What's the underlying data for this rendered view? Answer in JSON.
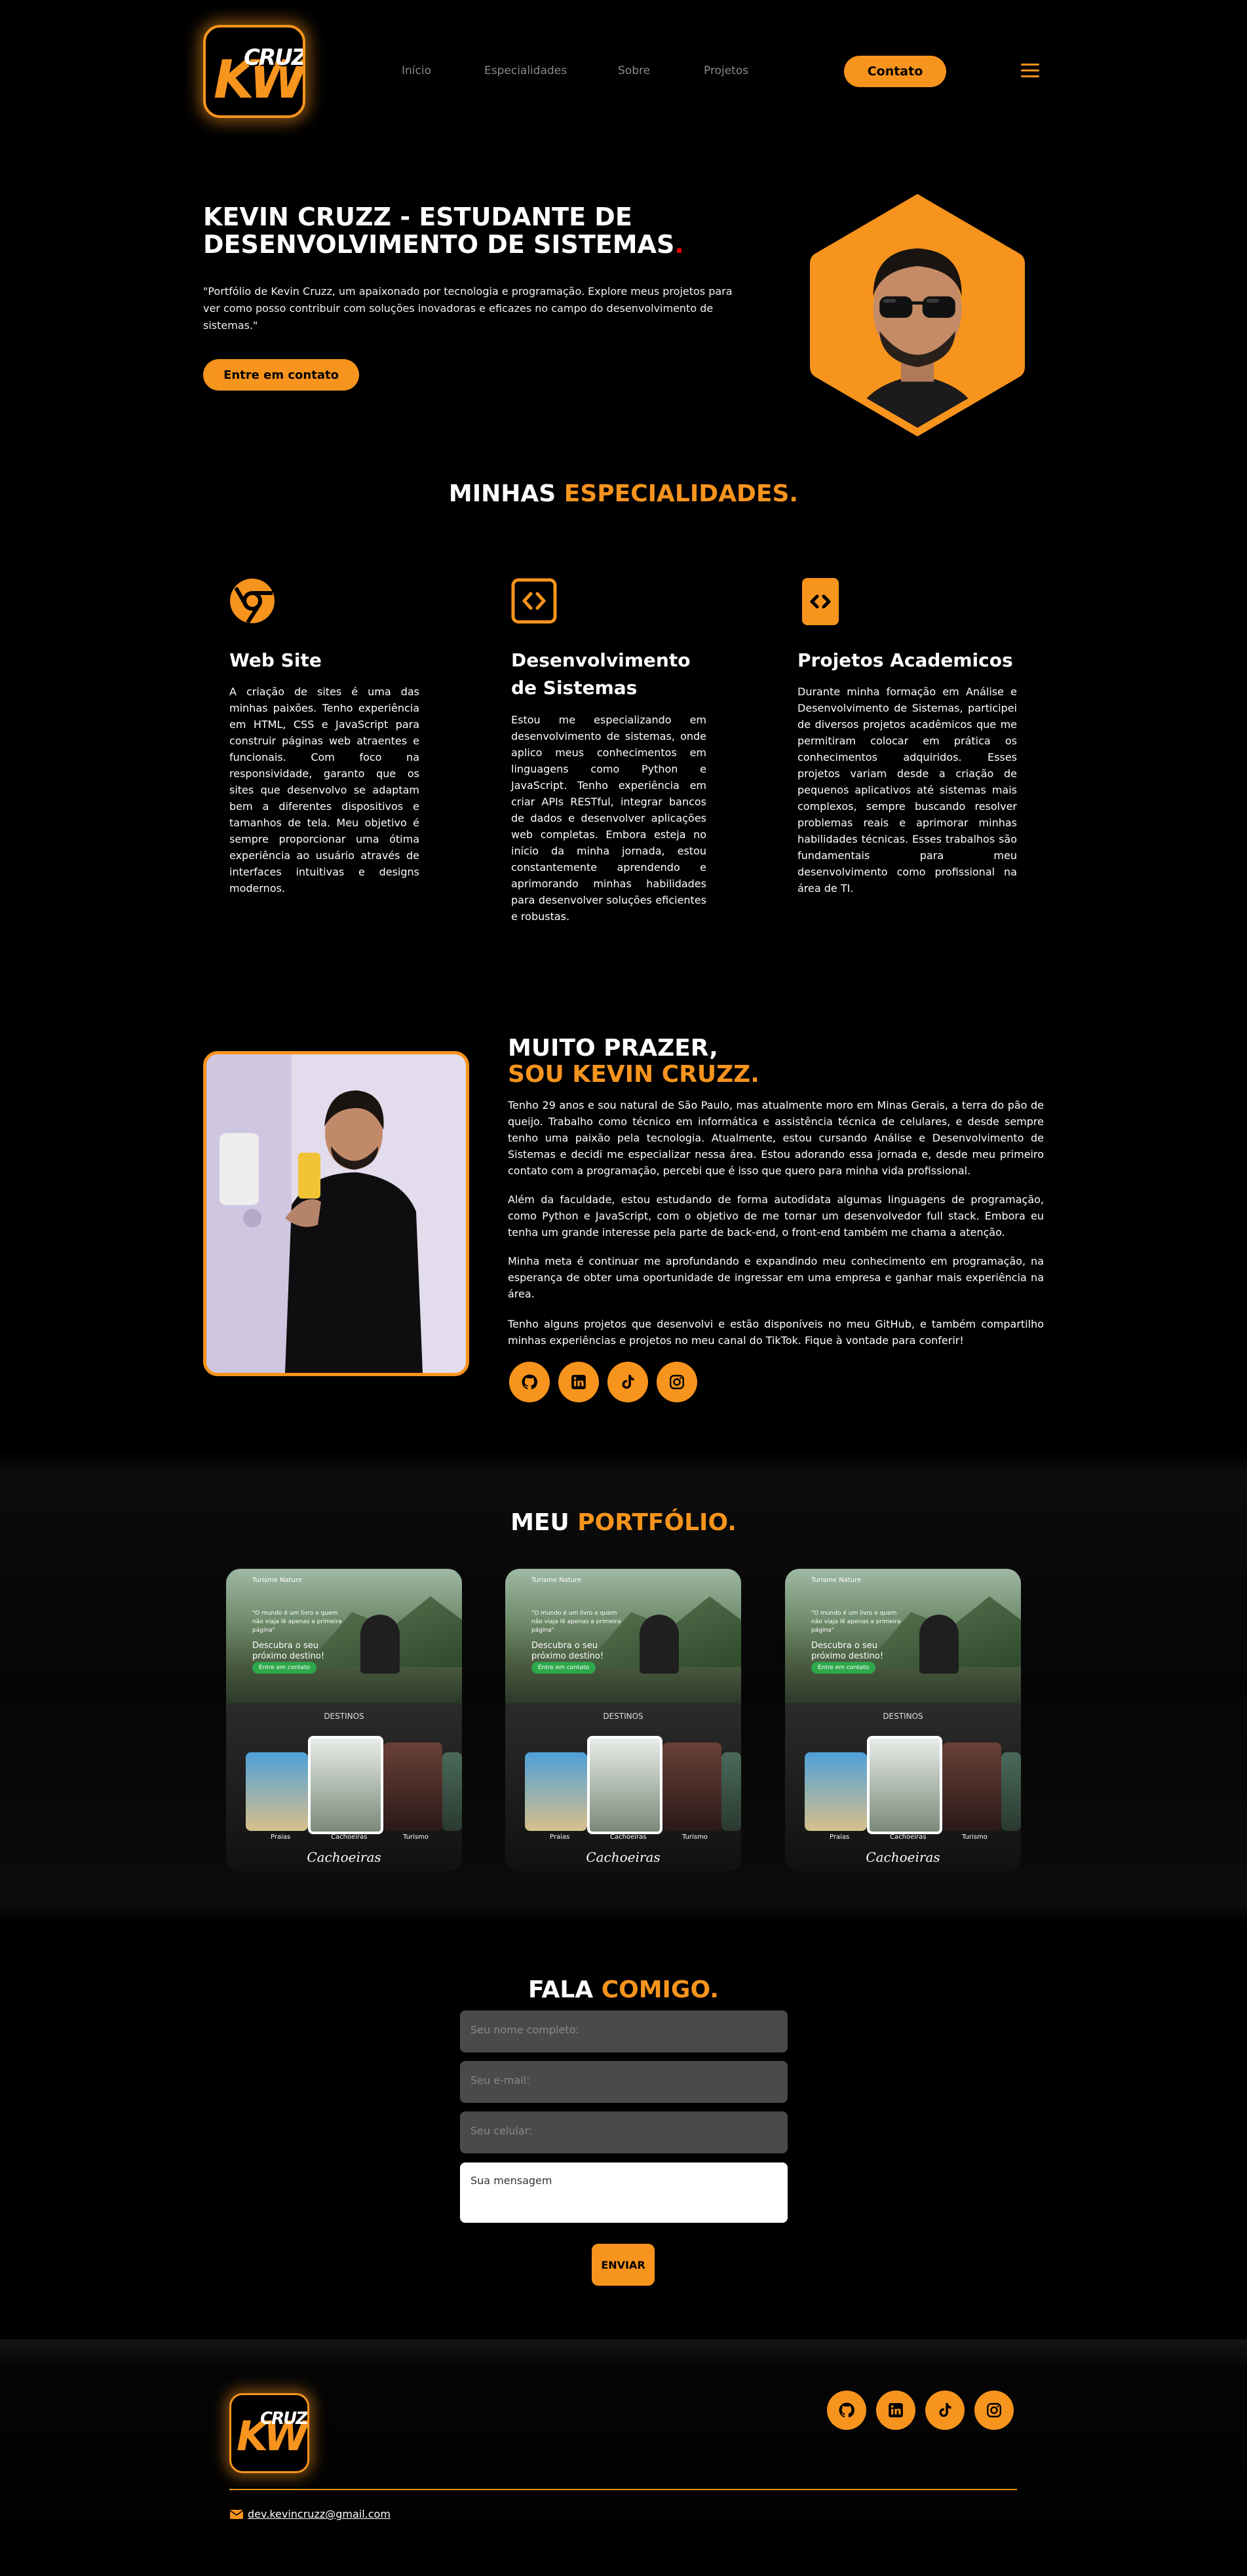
{
  "brand": {
    "logo_main": "KW",
    "logo_top": "CRUZZ"
  },
  "nav": {
    "items": [
      "Início",
      "Especialidades",
      "Sobre",
      "Projetos"
    ],
    "contact_label": "Contato"
  },
  "hero": {
    "title_line1": "KEVIN CRUZZ - ESTUDANTE DE",
    "title_line2": "DESENVOLVIMENTO DE SISTEMAS",
    "title_dot": ".",
    "description": "\"Portfólio de Kevin Cruzz, um apaixonado por tecnologia e programação. Explore meus projetos para ver como posso contribuir com soluções inovadoras e eficazes no campo do desenvolvimento de sistemas.\"",
    "button_label": "Entre em contato"
  },
  "specialties": {
    "title_white": "MINHAS",
    "title_orange": "ESPECIALIDADES.",
    "items": [
      {
        "icon": "chrome-icon",
        "title": "Web Site",
        "text": "A criação de sites é uma das minhas paixões. Tenho experiência em HTML, CSS e JavaScript para construir páginas web atraentes e funcionais. Com foco na responsividade, garanto que os sites que desenvolvo se adaptam bem a diferentes dispositivos e tamanhos de tela. Meu objetivo é sempre proporcionar uma ótima experiência ao usuário através de interfaces intuitivas e designs modernos."
      },
      {
        "icon": "code-icon",
        "title": "Desenvolvimento de Sistemas",
        "text": "Estou me especializando em desenvolvimento de sistemas, onde aplico meus conhecimentos em linguagens como Python e JavaScript. Tenho experiência em criar APIs RESTful, integrar bancos de dados e desenvolver aplicações web completas. Embora esteja no início da minha jornada, estou constantemente aprendendo e aprimorando minhas habilidades para desenvolver soluções eficientes e robustas."
      },
      {
        "icon": "code-square-icon",
        "title": "Projetos Academicos",
        "text": "Durante minha formação em Análise e Desenvolvimento de Sistemas, participei de diversos projetos acadêmicos que me permitiram colocar em prática os conhecimentos adquiridos. Esses projetos variam desde a criação de pequenos aplicativos até sistemas mais complexos, sempre buscando resolver problemas reais e aprimorar minhas habilidades técnicas. Esses trabalhos são fundamentais para meu desenvolvimento como profissional na área de TI."
      }
    ]
  },
  "about": {
    "title_line1": "MUITO PRAZER,",
    "title_line2": "SOU KEVIN CRUZZ.",
    "paragraphs": [
      "Tenho 29 anos e sou natural de São Paulo, mas atualmente moro em Minas Gerais, a terra do pão de queijo. Trabalho como técnico em informática e assistência técnica de celulares, e desde sempre tenho uma paixão pela tecnologia. Atualmente, estou cursando Análise e Desenvolvimento de Sistemas e decidi me especializar nessa área. Estou adorando essa jornada e, desde meu primeiro contato com a programação, percebi que é isso que quero para minha vida profissional.",
      "Além da faculdade, estou estudando de forma autodidata algumas linguagens de programação, como Python e JavaScript, com o objetivo de me tornar um desenvolvedor full stack. Embora eu tenha um grande interesse pela parte de back-end, o front-end também me chama a atenção.",
      "Minha meta é continuar me aprofundando e expandindo meu conhecimento em programação, na esperança de obter uma oportunidade de ingressar em uma empresa e ganhar mais experiência na área.",
      "Tenho alguns projetos que desenvolvi e estão disponíveis no meu GitHub, e também compartilho minhas experiências e projetos no meu canal do TikTok. Fique à vontade para conferir!"
    ],
    "social": [
      "github-icon",
      "linkedin-icon",
      "tiktok-icon",
      "instagram-icon"
    ]
  },
  "portfolio": {
    "title_white": "MEU",
    "title_orange": "PORTFÓLIO.",
    "cards": [
      {
        "brand": "Turisme Nature",
        "quote": "\"O mundo é um livro e quem não viaja lê apenas a primeira página\"",
        "heading": "Descubra o seu próximo destino!",
        "button": "Entre em contato",
        "section": "DESTINOS",
        "labels": [
          "Praias",
          "Cachoeiras",
          "Turismo"
        ],
        "script": "Cachoeiras"
      },
      {
        "brand": "Turisme Nature",
        "quote": "\"O mundo é um livro e quem não viaja lê apenas a primeira página\"",
        "heading": "Descubra o seu próximo destino!",
        "button": "Entre em contato",
        "section": "DESTINOS",
        "labels": [
          "Praias",
          "Cachoeiras",
          "Turismo"
        ],
        "script": "Cachoeiras"
      },
      {
        "brand": "Turisme Nature",
        "quote": "\"O mundo é um livro e quem não viaja lê apenas a primeira página\"",
        "heading": "Descubra o seu próximo destino!",
        "button": "Entre em contato",
        "section": "DESTINOS",
        "labels": [
          "Praias",
          "Cachoeiras",
          "Turismo"
        ],
        "script": "Cachoeiras"
      }
    ]
  },
  "contact": {
    "title_white": "FALA",
    "title_orange": "COMIGO.",
    "name_placeholder": "Seu nome completo:",
    "email_placeholder": "Seu e-mail:",
    "phone_placeholder": "Seu celular:",
    "message_placeholder": "Sua mensagem",
    "send_label": "ENVIAR"
  },
  "footer": {
    "email": "dev.kevincruzz@gmail.com",
    "social": [
      "github-icon",
      "linkedin-icon",
      "tiktok-icon",
      "instagram-icon"
    ]
  },
  "colors": {
    "accent": "#f7941d",
    "background": "#000000",
    "dot": "#e00000"
  }
}
